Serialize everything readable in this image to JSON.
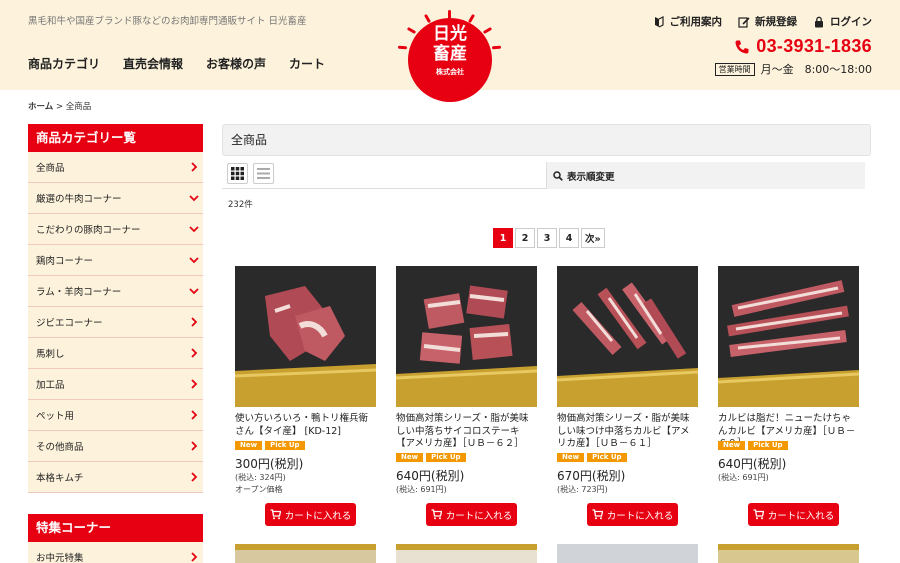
{
  "header": {
    "tagline": "黒毛和牛や国産ブランド豚などのお肉卸専門通販サイト 日光畜産",
    "nav": [
      "商品カテゴリ",
      "直売会情報",
      "お客様の声",
      "カート"
    ],
    "logo": {
      "line1": "日光",
      "line2": "畜産",
      "line3": "株式会社"
    },
    "links": {
      "guide": "ご利用案内",
      "register": "新規登録",
      "login": "ログイン"
    },
    "phone": "03-3931-1836",
    "hours_label": "営業時間",
    "hours": "月〜金　8:00〜18:00"
  },
  "breadcrumb": {
    "home": "ホーム",
    "sep": " > ",
    "current": "全商品"
  },
  "sidebar": {
    "heading": "商品カテゴリー覧",
    "items": [
      {
        "label": "全商品",
        "icon": "chevron-right-icon"
      },
      {
        "label": "厳選の牛肉コーナー",
        "icon": "chevron-down-icon"
      },
      {
        "label": "こだわりの豚肉コーナー",
        "icon": "chevron-down-icon"
      },
      {
        "label": "鶏肉コーナー",
        "icon": "chevron-down-icon"
      },
      {
        "label": "ラム・羊肉コーナー",
        "icon": "chevron-down-icon"
      },
      {
        "label": "ジビエコーナー",
        "icon": "chevron-right-icon"
      },
      {
        "label": "馬刺し",
        "icon": "chevron-right-icon"
      },
      {
        "label": "加工品",
        "icon": "chevron-right-icon"
      },
      {
        "label": "ペット用",
        "icon": "chevron-right-icon"
      },
      {
        "label": "その他商品",
        "icon": "chevron-right-icon"
      },
      {
        "label": "本格キムチ",
        "icon": "chevron-right-icon"
      }
    ],
    "special_heading": "特集コーナー",
    "special_items": [
      {
        "label": "お中元特集",
        "icon": "chevron-right-icon"
      }
    ]
  },
  "main": {
    "title": "全商品",
    "sort_label": "表示順変更",
    "count": "232件",
    "pages": [
      "1",
      "2",
      "3",
      "4",
      "次»"
    ],
    "active_page": "1"
  },
  "products": [
    {
      "name": "使い方いろいろ・鴨トリ権兵衛さん【タイ産】 [KD-12]",
      "badges": [
        "New",
        "Pick Up"
      ],
      "price": "300円(税別)",
      "tax": "(税込: 324円)",
      "note": "オープン価格",
      "cart": "カートに入れる"
    },
    {
      "name": "物価高対策シリーズ・脂が美味しい中落ちサイコロステーキ【アメリカ産】［ＵＢ－６２］",
      "badges": [
        "New",
        "Pick Up"
      ],
      "price": "640円(税別)",
      "tax": "(税込: 691円)",
      "note": "",
      "cart": "カートに入れる"
    },
    {
      "name": "物価高対策シリーズ・脂が美味しい味つけ中落ちカルビ【アメリカ産】［ＵＢ－６１］",
      "badges": [
        "New",
        "Pick Up"
      ],
      "price": "670円(税別)",
      "tax": "(税込: 723円)",
      "note": "",
      "cart": "カートに入れる"
    },
    {
      "name": "カルビは脂だ！ニューたけちゃんカルビ【アメリカ産】［ＵＢ－６０］",
      "badges": [
        "New",
        "Pick Up"
      ],
      "price": "640円(税別)",
      "tax": "(税込: 691円)",
      "note": "",
      "cart": "カートに入れる"
    }
  ],
  "colors": {
    "accent": "#e60012",
    "header_bg": "#fdf3dc",
    "badge": "#f39800"
  }
}
